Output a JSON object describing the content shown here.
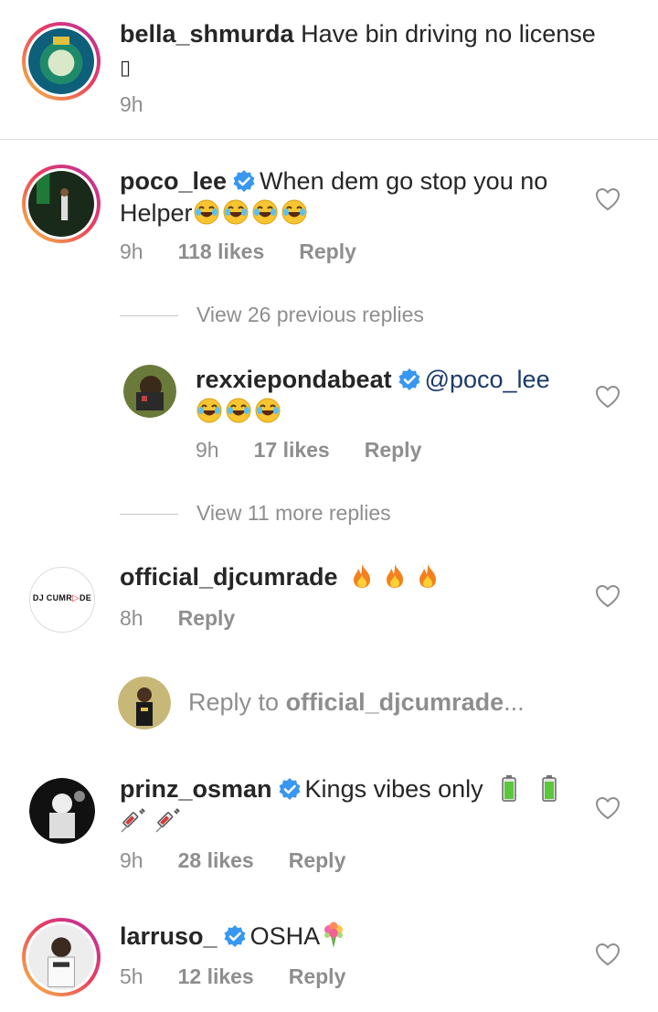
{
  "comments": [
    {
      "username": "bella_shmurda",
      "text": "Have bin driving no license",
      "extra_glyph": "▯",
      "time": "9h"
    },
    {
      "username": "poco_lee",
      "text_line1": "When dem go stop you no",
      "text_line2": "Helper",
      "emoji_count": 4,
      "time": "9h",
      "likes": "118 likes",
      "reply": "Reply"
    },
    {
      "view_replies": "View 26 previous replies"
    },
    {
      "username": "rexxiepondabeat",
      "mention": "@poco_lee",
      "time": "9h",
      "likes": "17 likes",
      "reply": "Reply"
    },
    {
      "view_replies": "View 11 more replies"
    },
    {
      "username": "official_djcumrade",
      "avatar_text": "DJ CUMR",
      "avatar_text2": "DE",
      "time": "8h",
      "reply": "Reply"
    },
    {
      "reply_to_prefix": "Reply to ",
      "reply_to_user": "official_djcumrade",
      "reply_to_suffix": "..."
    },
    {
      "username": "prinz_osman",
      "text": "Kings vibes only",
      "time": "9h",
      "likes": "28 likes",
      "reply": "Reply"
    },
    {
      "username": "larruso_",
      "text": "OSHA",
      "time": "5h",
      "likes": "12 likes",
      "reply": "Reply"
    }
  ],
  "colors": {
    "text": "#262626",
    "meta": "#8e8e8e",
    "verified": "#3897f0",
    "mention": "#1b3a6b"
  }
}
